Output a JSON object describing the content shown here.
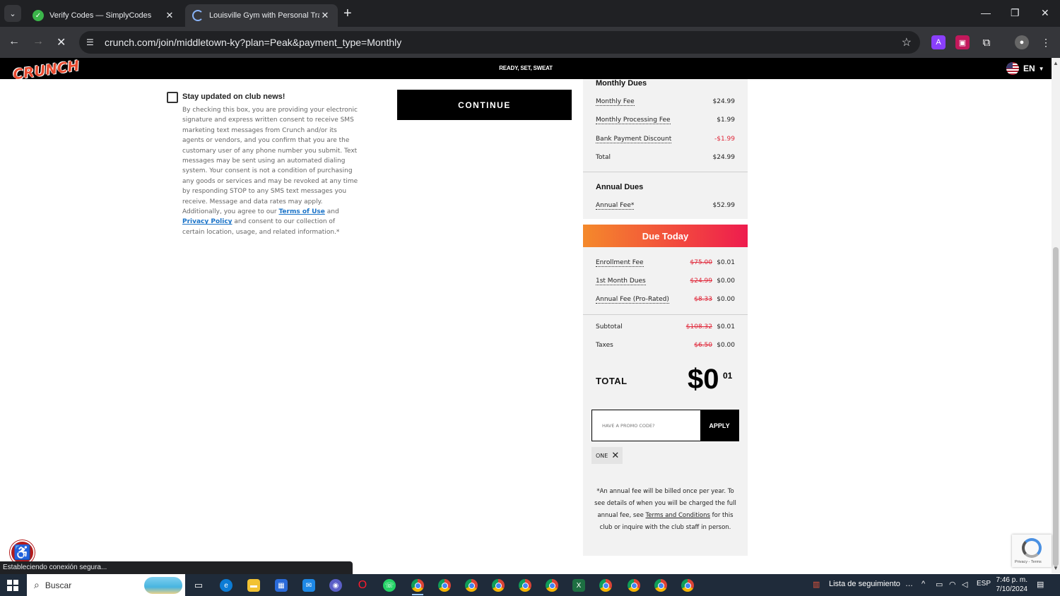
{
  "browser": {
    "tabs": [
      {
        "title": "Verify Codes — SimplyCodes"
      },
      {
        "title": "Louisville Gym with Personal Trainers"
      }
    ],
    "url": "crunch.com/join/middletown-ky?plan=Peak&payment_type=Monthly",
    "status_text": "Estableciendo conexión segura..."
  },
  "site": {
    "logo": "CRUNCH",
    "tagline": "READY, SET, SWEAT",
    "language": "EN"
  },
  "optin": {
    "title": "Stay updated on club news!",
    "body_1": "By checking this box, you are providing your electronic signature and express written consent to receive SMS marketing text messages from Crunch and/or its agents or vendors, and you confirm that you are the customary user of any phone number you submit. Text messages may be sent using an automated dialing system. Your consent is not a condition of purchasing any goods or services and may be revoked at any time by responding STOP to any SMS text messages you receive. Message and data rates may apply. Additionally, you agree to our",
    "terms_link": "Terms of Use",
    "and": "and",
    "privacy_link": "Privacy Policy",
    "body_2": "and consent to our collection of certain location, usage, and related information.*"
  },
  "continue_label": "CONTINUE",
  "summary": {
    "monthly": {
      "title": "Monthly Dues",
      "rows": [
        {
          "label": "Monthly Fee",
          "value": "$24.99"
        },
        {
          "label": "Monthly Processing Fee",
          "value": "$1.99"
        },
        {
          "label": "Bank Payment Discount",
          "value": "-$1.99"
        },
        {
          "label": "Total",
          "value": "$24.99"
        }
      ]
    },
    "annual": {
      "title": "Annual Dues",
      "rows": [
        {
          "label": "Annual Fee*",
          "value": "$52.99"
        }
      ]
    },
    "due_today": {
      "title": "Due Today",
      "rows": [
        {
          "label": "Enrollment Fee",
          "old": "$75.00",
          "value": "$0.01"
        },
        {
          "label": "1st Month Dues",
          "old": "$24.99",
          "value": "$0.00"
        },
        {
          "label": "Annual Fee (Pro-Rated)",
          "old": "$8.33",
          "value": "$0.00"
        }
      ]
    },
    "subtotal": {
      "label": "Subtotal",
      "old": "$108.32",
      "value": "$0.01"
    },
    "taxes": {
      "label": "Taxes",
      "old": "$6.50",
      "value": "$0.00"
    },
    "total": {
      "label": "TOTAL",
      "dollars": "$0",
      "cents": "01"
    },
    "promo": {
      "placeholder": "HAVE A PROMO CODE?",
      "apply_label": "APPLY",
      "applied_code": "ONE"
    },
    "footnote_1": "*An annual fee will be billed once per year. To see details of when you will be charged the full annual fee, see",
    "footnote_link": "Terms and Conditions",
    "footnote_2": "for this club or inquire with the club staff in person."
  },
  "recaptcha": {
    "links": "Privacy - Terms"
  },
  "taskbar": {
    "search_label": "Buscar",
    "watchlist": "Lista de seguimiento",
    "lang": "ESP",
    "time": "7:46 p. m.",
    "date": "7/10/2024"
  },
  "colors": {
    "accent_red": "#e0283a",
    "due_gradient_start": "#f4892b",
    "due_gradient_end": "#ee1c4e"
  }
}
